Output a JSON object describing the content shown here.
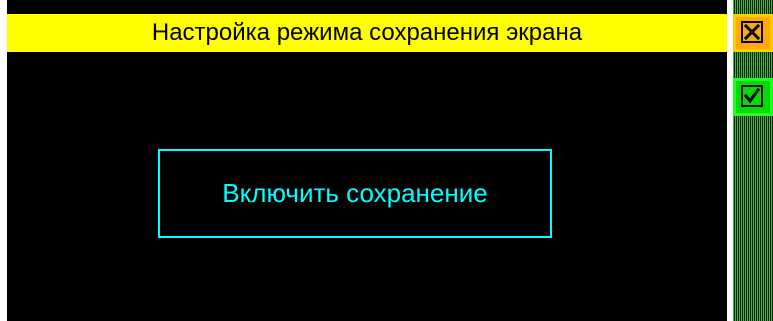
{
  "screen": {
    "title": "Настройка режима сохранения экрана",
    "enable_button_label": "Включить сохранение"
  },
  "side_panel": {
    "close_icon": "close-icon",
    "confirm_icon": "checkmark-icon"
  },
  "colors": {
    "background": "#000000",
    "title_bar": "#ffff00",
    "button_accent": "#00ffff",
    "close_button": "#ffaa00",
    "confirm_button": "#00dd00",
    "side_panel": "#33bb33"
  }
}
